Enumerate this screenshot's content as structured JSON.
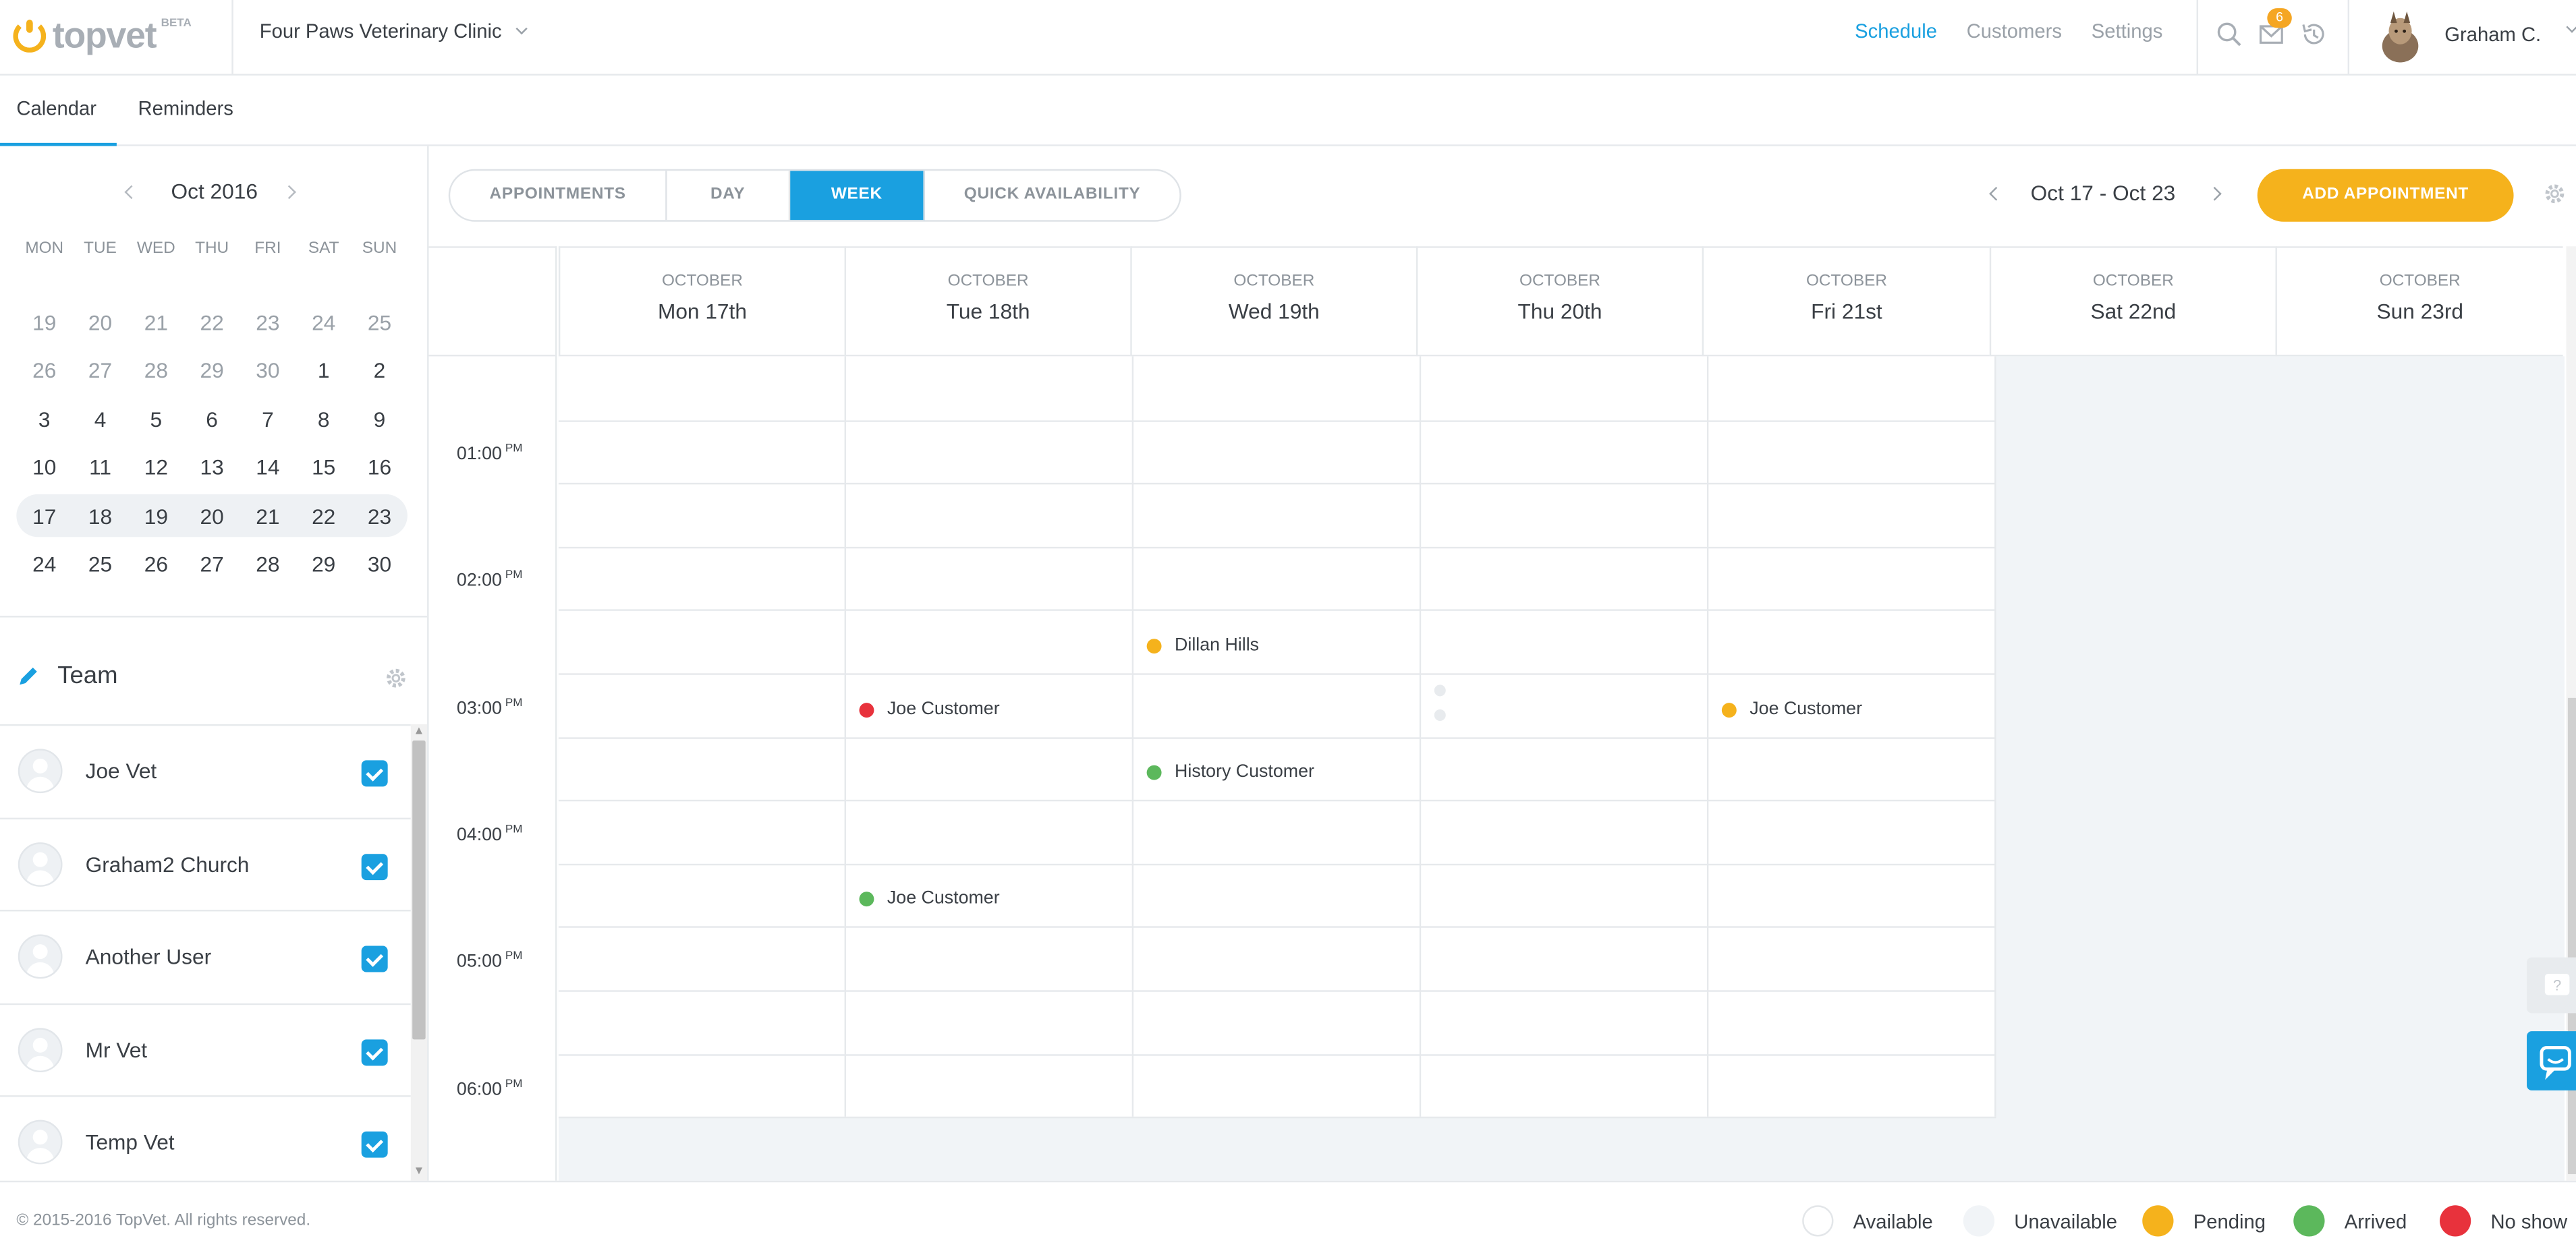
{
  "brand": {
    "name": "topvet",
    "badge": "BETA"
  },
  "clinic": {
    "name": "Four Paws Veterinary Clinic"
  },
  "nav": {
    "items": [
      {
        "label": "Schedule",
        "active": true
      },
      {
        "label": "Customers",
        "active": false
      },
      {
        "label": "Settings",
        "active": false
      }
    ]
  },
  "notifications": {
    "count": "6"
  },
  "user": {
    "name": "Graham C."
  },
  "subtabs": [
    {
      "label": "Calendar",
      "active": true
    },
    {
      "label": "Reminders",
      "active": false
    }
  ],
  "mini_calendar": {
    "month": "Oct 2016",
    "weekdays": [
      "MON",
      "TUE",
      "WED",
      "THU",
      "FRI",
      "SAT",
      "SUN"
    ],
    "weeks": [
      {
        "days": [
          "19",
          "20",
          "21",
          "22",
          "23",
          "24",
          "25"
        ],
        "muted": [
          true,
          true,
          true,
          true,
          true,
          true,
          true
        ],
        "selected": false
      },
      {
        "days": [
          "26",
          "27",
          "28",
          "29",
          "30",
          "1",
          "2"
        ],
        "muted": [
          true,
          true,
          true,
          true,
          true,
          false,
          false
        ],
        "selected": false
      },
      {
        "days": [
          "3",
          "4",
          "5",
          "6",
          "7",
          "8",
          "9"
        ],
        "muted": [
          false,
          false,
          false,
          false,
          false,
          false,
          false
        ],
        "selected": false
      },
      {
        "days": [
          "10",
          "11",
          "12",
          "13",
          "14",
          "15",
          "16"
        ],
        "muted": [
          false,
          false,
          false,
          false,
          false,
          false,
          false
        ],
        "selected": false
      },
      {
        "days": [
          "17",
          "18",
          "19",
          "20",
          "21",
          "22",
          "23"
        ],
        "muted": [
          false,
          false,
          false,
          false,
          false,
          false,
          false
        ],
        "selected": true
      },
      {
        "days": [
          "24",
          "25",
          "26",
          "27",
          "28",
          "29",
          "30"
        ],
        "muted": [
          false,
          false,
          false,
          false,
          false,
          false,
          false
        ],
        "selected": false
      }
    ]
  },
  "team": {
    "title": "Team",
    "members": [
      {
        "name": "Joe Vet",
        "checked": true
      },
      {
        "name": "Graham2 Church",
        "checked": true
      },
      {
        "name": "Another User",
        "checked": true
      },
      {
        "name": "Mr Vet",
        "checked": true
      },
      {
        "name": "Temp Vet",
        "checked": true
      }
    ]
  },
  "toolbar": {
    "views": [
      {
        "label": "APPOINTMENTS",
        "active": false
      },
      {
        "label": "DAY",
        "active": false
      },
      {
        "label": "WEEK",
        "active": true
      },
      {
        "label": "QUICK AVAILABILITY",
        "active": false
      }
    ],
    "range": "Oct 17 - Oct 23",
    "add_label": "ADD APPOINTMENT"
  },
  "week": {
    "days": [
      {
        "month": "OCTOBER",
        "date": "Mon 17th"
      },
      {
        "month": "OCTOBER",
        "date": "Tue 18th"
      },
      {
        "month": "OCTOBER",
        "date": "Wed 19th"
      },
      {
        "month": "OCTOBER",
        "date": "Thu 20th"
      },
      {
        "month": "OCTOBER",
        "date": "Fri 21st"
      },
      {
        "month": "OCTOBER",
        "date": "Sat 22nd"
      },
      {
        "month": "OCTOBER",
        "date": "Sun 23rd"
      }
    ],
    "times": [
      {
        "time": "01:00",
        "ampm": "PM"
      },
      {
        "time": "02:00",
        "ampm": "PM"
      },
      {
        "time": "03:00",
        "ampm": "PM"
      },
      {
        "time": "04:00",
        "ampm": "PM"
      },
      {
        "time": "05:00",
        "ampm": "PM"
      },
      {
        "time": "06:00",
        "ampm": "PM"
      }
    ]
  },
  "appointments": [
    {
      "name": "Dillan Hills",
      "day": "Wed 19th",
      "start": "02:30 PM",
      "status": "pending"
    },
    {
      "name": "Joe Customer",
      "day": "Tue 18th",
      "start": "03:00 PM",
      "status": "no_show"
    },
    {
      "name": "Joe Customer",
      "day": "Fri 21st",
      "start": "03:00 PM",
      "status": "pending"
    },
    {
      "name": "History Customer",
      "day": "Wed 19th",
      "start": "03:30 PM",
      "status": "arrived"
    },
    {
      "name": "Joe Customer",
      "day": "Tue 18th",
      "start": "04:30 PM",
      "status": "arrived"
    }
  ],
  "status_colors": {
    "available": "#ffffff",
    "unavailable": "#f1f4f7",
    "pending": "#f5b21c",
    "arrived": "#5cb85c",
    "no_show": "#e8323c"
  },
  "footer": {
    "copyright": "© 2015-2016 TopVet. All rights reserved.",
    "legend": [
      {
        "label": "Available",
        "color": "#ffffff"
      },
      {
        "label": "Unavailable",
        "color": "#f1f4f7"
      },
      {
        "label": "Pending",
        "color": "#f5b21c"
      },
      {
        "label": "Arrived",
        "color": "#5cb85c"
      },
      {
        "label": "No show",
        "color": "#e8323c"
      }
    ]
  }
}
